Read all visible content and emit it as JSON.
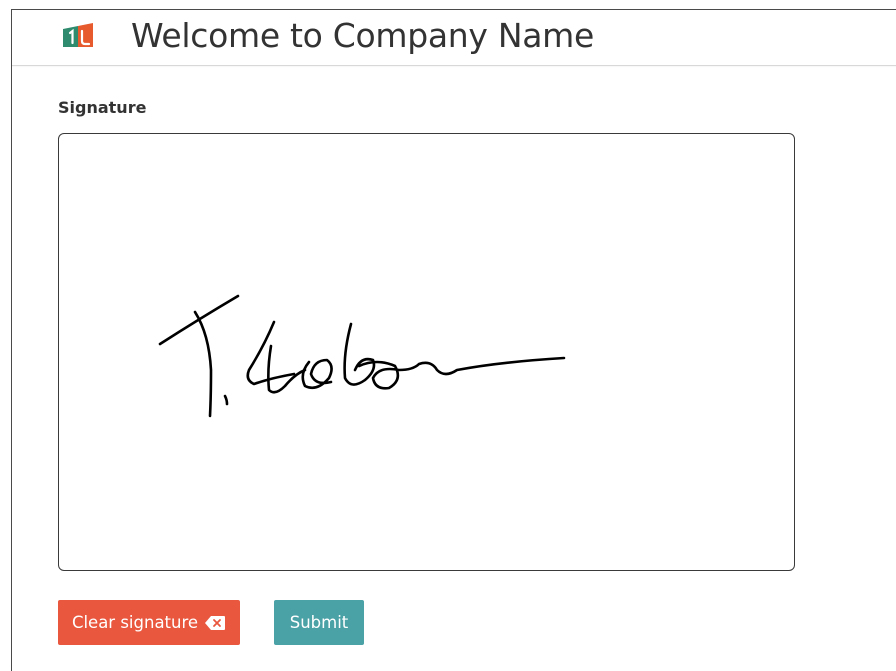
{
  "header": {
    "title": "Welcome to Company Name",
    "logo_icon": "company-logo-icon"
  },
  "form": {
    "signature_label": "Signature"
  },
  "buttons": {
    "clear_label": "Clear signature",
    "clear_icon": "backspace-icon",
    "submit_label": "Submit"
  },
  "colors": {
    "clear_button": "#e9573f",
    "submit_button": "#4aa1a6",
    "logo_green": "#2e8b6d",
    "logo_orange": "#e65a2e",
    "ink": "#000000"
  }
}
